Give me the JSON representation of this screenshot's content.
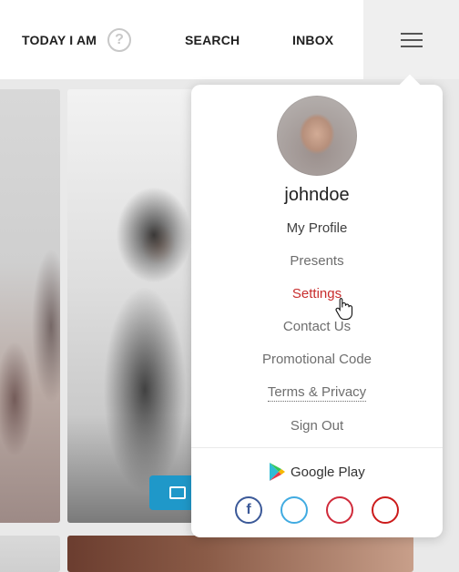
{
  "nav": {
    "today": "TODAY I AM",
    "help": "?",
    "search": "SEARCH",
    "inbox": "INBOX",
    "menu_icon": "hamburger-icon"
  },
  "user": {
    "username": "johndoe"
  },
  "menu": {
    "items": [
      {
        "label": "My Profile"
      },
      {
        "label": "Presents"
      },
      {
        "label": "Settings",
        "active": true
      },
      {
        "label": "Contact Us"
      },
      {
        "label": "Promotional Code"
      },
      {
        "label": "Terms & Privacy"
      },
      {
        "label": "Sign Out"
      }
    ],
    "google_play": "Google Play"
  },
  "social": {
    "facebook": "f",
    "icons": [
      "facebook-icon",
      "twitter-icon",
      "instagram-icon",
      "youtube-icon"
    ]
  },
  "colors": {
    "active_item": "#c82d2d",
    "video_button": "#1f98c9",
    "facebook": "#3b5998",
    "twitter": "#41abe1",
    "instagram": "#d02b3b",
    "youtube": "#cc1b1b"
  }
}
